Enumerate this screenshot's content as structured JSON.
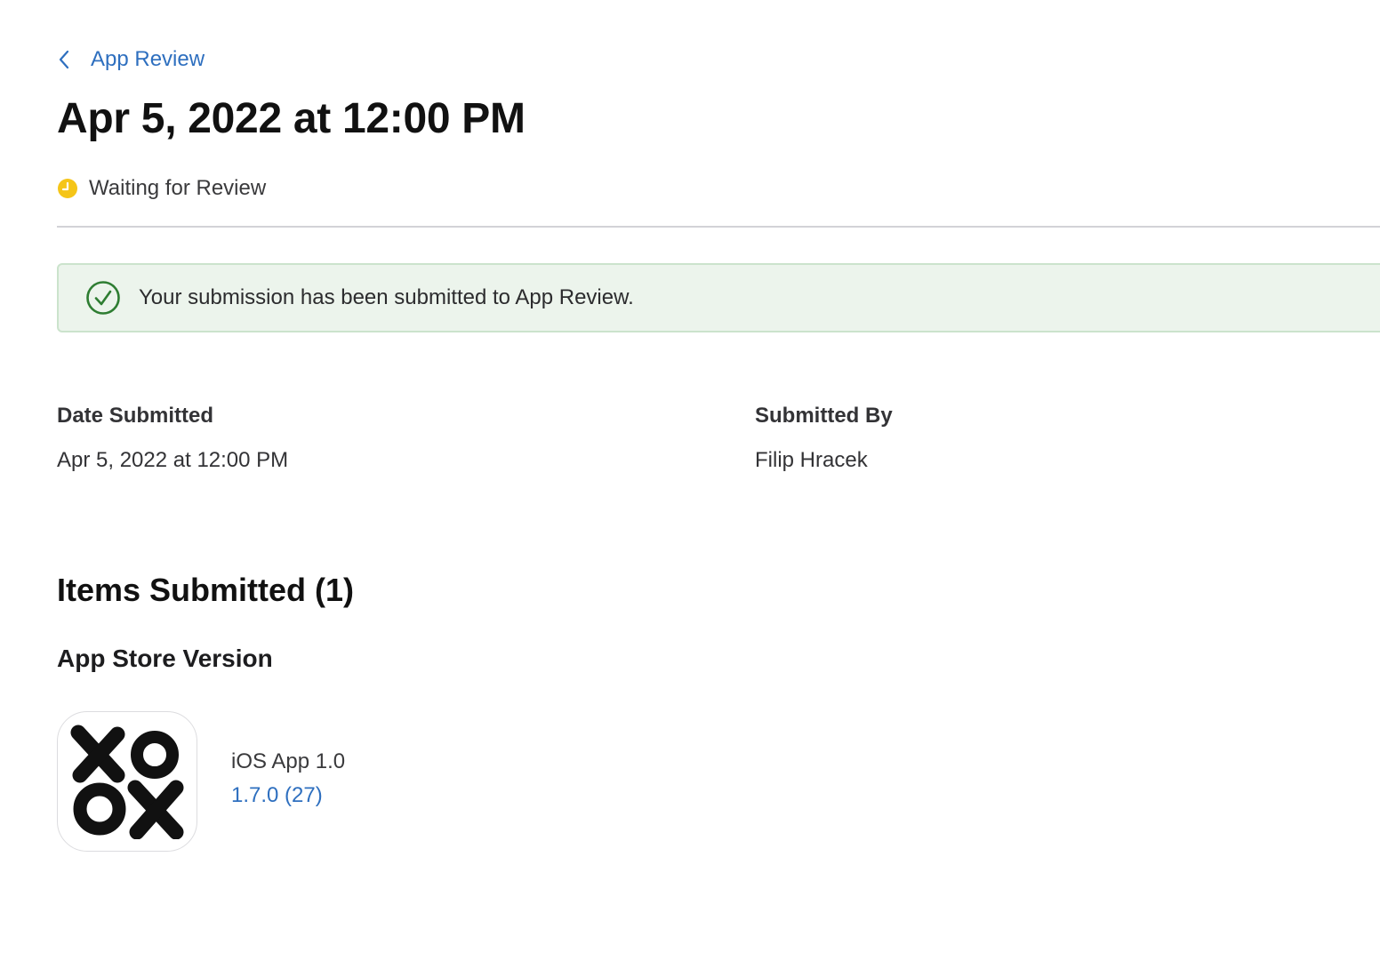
{
  "nav": {
    "back_label": "App Review"
  },
  "header": {
    "title": "Apr 5, 2022 at 12:00 PM",
    "status": "Waiting for Review",
    "status_color": "#f5c518"
  },
  "banner": {
    "message": "Your submission has been submitted to App Review.",
    "icon": "checkmark-circle-icon",
    "accent_color": "#2e7d32"
  },
  "details": {
    "date_submitted_label": "Date Submitted",
    "date_submitted_value": "Apr 5, 2022 at 12:00 PM",
    "submitted_by_label": "Submitted By",
    "submitted_by_value": "Filip Hracek"
  },
  "items": {
    "section_title": "Items Submitted (1)",
    "group_title": "App Store Version",
    "entries": [
      {
        "name": "iOS App 1.0",
        "version": "1.7.0 (27)",
        "icon": "xo-game-app-icon"
      }
    ]
  },
  "colors": {
    "link": "#2e6fbf",
    "banner_background": "#ecf4ec"
  }
}
